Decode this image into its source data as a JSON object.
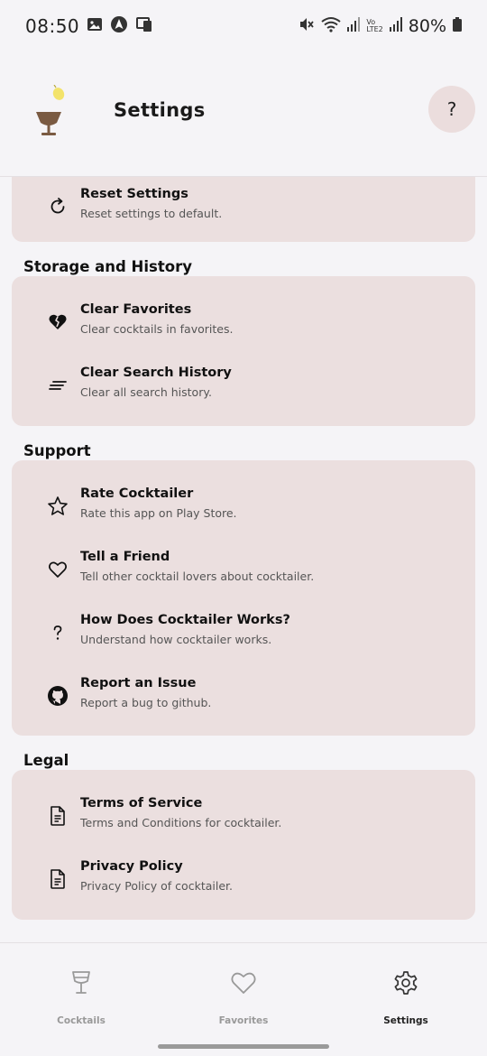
{
  "status_bar": {
    "time": "08:50",
    "battery": "80%",
    "lte_label_top": "Vo",
    "lte_label_bottom": "LTE2"
  },
  "header": {
    "title": "Settings",
    "help_label": "?",
    "logo_colors": {
      "cup": "#7a5a42",
      "lemon": "#f3e36b"
    }
  },
  "top_card": {
    "items": [
      {
        "icon": "reset-icon",
        "title": "Reset Settings",
        "subtitle": "Reset settings to default."
      }
    ]
  },
  "sections": [
    {
      "title": "Storage and History",
      "items": [
        {
          "icon": "broken-heart-icon",
          "title": "Clear Favorites",
          "subtitle": "Clear cocktails in favorites."
        },
        {
          "icon": "clear-lines-icon",
          "title": "Clear Search History",
          "subtitle": "Clear all search history."
        }
      ]
    },
    {
      "title": "Support",
      "items": [
        {
          "icon": "star-icon",
          "title": "Rate Cocktailer",
          "subtitle": "Rate this app on Play Store."
        },
        {
          "icon": "heart-icon",
          "title": "Tell a Friend",
          "subtitle": "Tell other cocktail lovers about cocktailer."
        },
        {
          "icon": "question-icon",
          "title": "How Does Cocktailer Works?",
          "subtitle": "Understand how cocktailer works."
        },
        {
          "icon": "github-icon",
          "title": "Report an Issue",
          "subtitle": "Report a bug to github."
        }
      ]
    },
    {
      "title": "Legal",
      "items": [
        {
          "icon": "document-icon",
          "title": "Terms of Service",
          "subtitle": "Terms and Conditions for cocktailer."
        },
        {
          "icon": "document-icon",
          "title": "Privacy Policy",
          "subtitle": "Privacy Policy of cocktailer."
        }
      ]
    }
  ],
  "bottom_nav": {
    "items": [
      {
        "icon": "cocktail-glass-icon",
        "label": "Cocktails",
        "active": false
      },
      {
        "icon": "heart-outline-icon",
        "label": "Favorites",
        "active": false
      },
      {
        "icon": "gear-icon",
        "label": "Settings",
        "active": true
      }
    ]
  },
  "colors": {
    "card_bg": "#ebdfdf",
    "page_bg": "#f5f4f7",
    "help_bg": "#ebdddd"
  }
}
